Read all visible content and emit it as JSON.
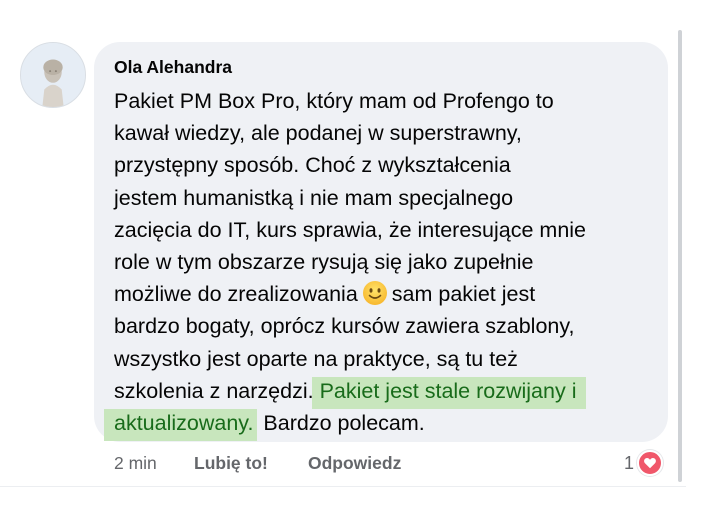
{
  "comment": {
    "author": "Ola Alehandra",
    "lines": [
      "Pakiet PM Box Pro, który mam od Profengo to",
      "kawał wiedzy, ale podanej w superstrawny,",
      "przystępny sposób. Choć z wykształcenia",
      "jestem humanistką i nie mam specjalnego",
      "zacięcia do IT, kurs sprawia, że interesujące mnie",
      "role w tym obszarze rysują się jako zupełnie"
    ],
    "line7_before_emoji": "możliwe do zrealizowania",
    "line7_after_emoji": "sam pakiet jest",
    "line8": "bardzo bogaty, oprócz kursów zawiera szablony,",
    "line9": "wszystko jest oparte na praktyce, są tu też",
    "line10_plain": "szkolenia z narzędzi.",
    "line10_highlight": "Pakiet jest stale rozwijany i",
    "line11_highlight": "aktualizowany.",
    "line11_plain": "Bardzo polecam.",
    "emoji": "slightly-smiling-face-icon",
    "highlight_color": "#c8e6bd",
    "highlight_text_color": "#186b1a"
  },
  "footer": {
    "time": "2 min",
    "like_label": "Lubię to!",
    "reply_label": "Odpowiedz"
  },
  "reactions": {
    "count": "1",
    "type": "heart-icon",
    "color": "#f0576a"
  }
}
